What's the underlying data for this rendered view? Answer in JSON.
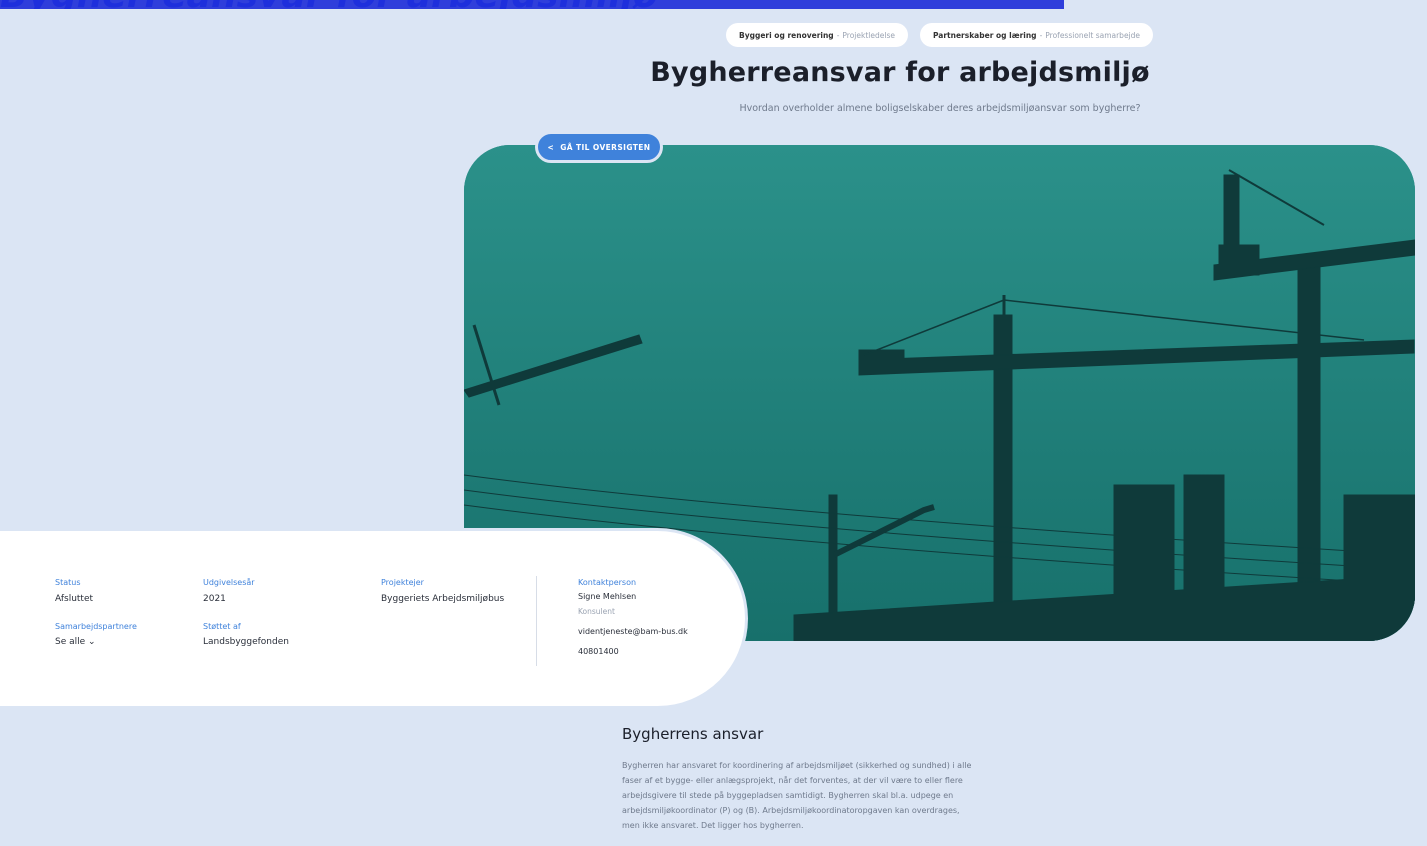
{
  "pills": [
    {
      "bold": "Byggeri og renovering",
      "sep": "-",
      "sub": "Projektledelse"
    },
    {
      "bold": "Partnerskaber og læring",
      "sep": "-",
      "sub": "Professionelt samarbejde"
    }
  ],
  "title": "Bygherreansvar for arbejdsmiljø",
  "subtitle": "Hvordan overholder almene boligselskaber deres arbejdsmiljøansvar som bygherre?",
  "back_button": {
    "label": "GÅ TIL OVERSIGTEN",
    "icon": "<"
  },
  "info": {
    "status": {
      "label": "Status",
      "value": "Afsluttet"
    },
    "year": {
      "label": "Udgivelsesår",
      "value": "2021"
    },
    "owner": {
      "label": "Projektejer",
      "value": "Byggeriets Arbejdsmiljøbus"
    },
    "partners": {
      "label": "Samarbejdspartnere",
      "value": "Se alle ⌄"
    },
    "funder": {
      "label": "Støttet af",
      "value": "Landsbyggefonden"
    },
    "contact": {
      "label": "Kontaktperson",
      "name": "Signe Mehlsen",
      "role": "Konsulent",
      "email": "videntjeneste@bam-bus.dk",
      "phone": "40801400"
    }
  },
  "article": {
    "heading": "Bygherrens ansvar",
    "body": "Bygherren har ansvaret for koordinering af arbejdsmiljøet (sikkerhed og sundhed) i alle faser af et bygge- eller anlægsprojekt, når det forventes, at der vil være to eller flere arbejdsgivere til stede på byggepladsen samtidigt. Bygherren skal bl.a. udpege en arbejdsmiljøkoordinator (P) og (B). Arbejdsmiljøkoordinatoropgaven kan overdrages, men ikke ansvaret. Det ligger hos bygherren."
  },
  "colors": {
    "accent": "#3f82db",
    "background": "#dbe5f4",
    "hero_tint": "#1e7b76"
  }
}
